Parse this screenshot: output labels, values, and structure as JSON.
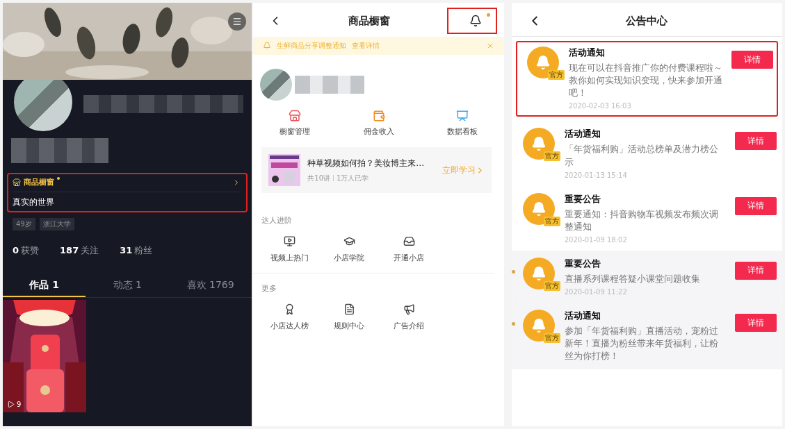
{
  "profile_screen": {
    "menu_button": true,
    "showcase": {
      "label": "商品橱窗",
      "dot": true,
      "highlighted": true,
      "bio": "真实的世界"
    },
    "tags": [
      "49岁",
      "浙江大学"
    ],
    "stats": [
      {
        "value": "0",
        "label": "获赞"
      },
      {
        "value": "187",
        "label": "关注"
      },
      {
        "value": "31",
        "label": "粉丝"
      }
    ],
    "tabs": [
      {
        "label": "作品 1",
        "selected": true
      },
      {
        "label": "动态 1",
        "selected": false
      },
      {
        "label": "喜欢 1769",
        "selected": false
      }
    ],
    "videos": [
      {
        "kind": "picture",
        "plays": "9"
      }
    ]
  },
  "showcase_screen": {
    "title": "商品橱窗",
    "bell": {
      "dot": true,
      "highlighted": true
    },
    "notice_bar": {
      "text": "生鲜商品分享调整通知",
      "link": "查看详情"
    },
    "tools": [
      {
        "label": "橱窗管理"
      },
      {
        "label": "佣金收入"
      },
      {
        "label": "数据看板"
      }
    ],
    "course": {
      "title": "种草视频如何拍？美妆博主来…",
      "lessons": "共10讲",
      "learners": "1万人已学",
      "action": "立即学习"
    },
    "sections": [
      {
        "title": "达人进阶",
        "items": [
          "视频上热门",
          "小店学院",
          "开通小店"
        ]
      },
      {
        "title": "更多",
        "items": [
          "小店达人榜",
          "规则中心",
          "广告介绍"
        ]
      }
    ]
  },
  "notice_screen": {
    "title": "公告中心",
    "notices": [
      {
        "title": "活动通知",
        "badge": "官方",
        "body": "现在可以在抖音推广你的付费课程啦～教你如何实现知识变现，快来参加开通吧！",
        "date": "2020-02-03 16:03",
        "button": "详情",
        "unread": false,
        "highlighted": true
      },
      {
        "title": "活动通知",
        "badge": "官方",
        "body": "「年货福利购」活动总榜单及潜力榜公示",
        "date": "2020-01-13 15:14",
        "button": "详情",
        "unread": false,
        "highlighted": false
      },
      {
        "title": "重要公告",
        "badge": "官方",
        "body": "重要通知：抖音购物车视频发布频次调整通知",
        "date": "2020-01-09 18:02",
        "button": "详情",
        "unread": false,
        "highlighted": false
      },
      {
        "title": "重要公告",
        "badge": "官方",
        "body": "直播系列课程答疑小课堂问题收集",
        "date": "2020-01-09 11:22",
        "button": "详情",
        "unread": true,
        "highlighted": false
      },
      {
        "title": "活动通知",
        "badge": "官方",
        "body": "参加「年货福利购」直播活动，宠粉过新年！直播为粉丝带来年货福利，让粉丝为你打榜！",
        "button": "详情",
        "unread": true,
        "highlighted": false
      }
    ]
  }
}
